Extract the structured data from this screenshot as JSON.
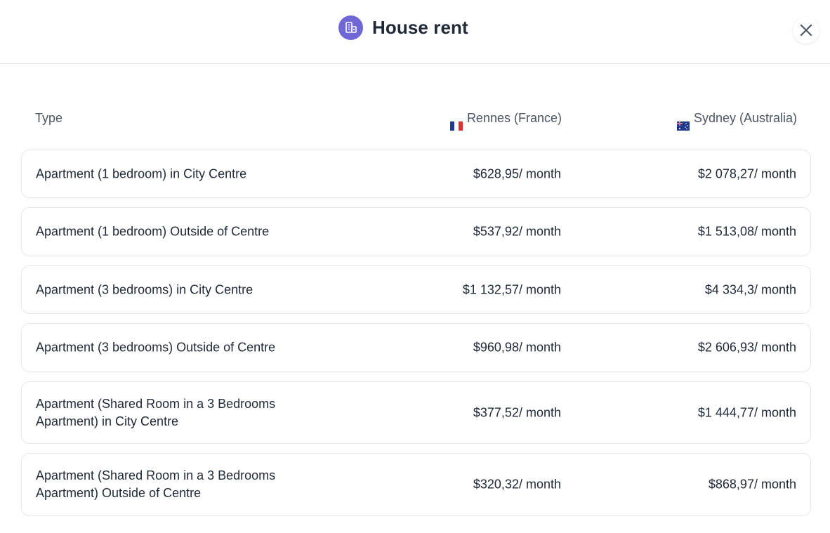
{
  "modal": {
    "title": "House rent",
    "icon": "building-icon",
    "accent_color": "#7067d6"
  },
  "table": {
    "headers": {
      "type": "Type",
      "city1": "Rennes (France)",
      "city2": "Sydney (Australia)"
    },
    "rows": [
      {
        "type": "Apartment (1 bedroom) in City Centre",
        "city1": "$628,95/ month",
        "city2": "$2 078,27/ month"
      },
      {
        "type": "Apartment (1 bedroom) Outside of Centre",
        "city1": "$537,92/ month",
        "city2": "$1 513,08/ month"
      },
      {
        "type": "Apartment (3 bedrooms) in City Centre",
        "city1": "$1 132,57/ month",
        "city2": "$4 334,3/ month"
      },
      {
        "type": "Apartment (3 bedrooms) Outside of Centre",
        "city1": "$960,98/ month",
        "city2": "$2 606,93/ month"
      },
      {
        "type": "Apartment (Shared Room in a 3 Bedrooms Apartment) in City Centre",
        "city1": "$377,52/ month",
        "city2": "$1 444,77/ month"
      },
      {
        "type": "Apartment (Shared Room in a 3 Bedrooms Apartment) Outside of Centre",
        "city1": "$320,32/ month",
        "city2": "$868,97/ month"
      }
    ]
  }
}
